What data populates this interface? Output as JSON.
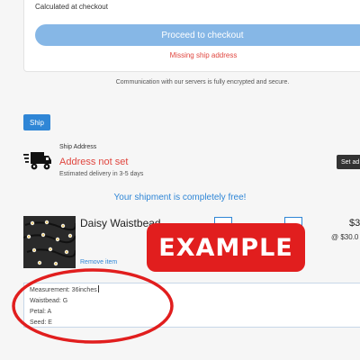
{
  "summary": {
    "calculated_text": "Calculated at checkout",
    "checkout_label": "Proceed to checkout",
    "missing_text": "Missing ship address",
    "secure_text": "Communication with our servers is fully encrypted and secure."
  },
  "ship": {
    "tab_label": "Ship",
    "address_label": "Ship Address",
    "address_status": "Address not set",
    "estimated_delivery": "Estimated delivery in 3-5 days",
    "set_address_label": "Set ad",
    "free_shipping": "Your shipment is completely free!"
  },
  "item": {
    "name": "Daisy Waistbead",
    "price": "$3",
    "unit_price": "@ $30.0",
    "remove_label": "Remove item",
    "notes": [
      "Measurement: 36inches",
      "Waistbead: G",
      "Petal: A",
      "Seed: E"
    ]
  },
  "overlay": {
    "example_label": "EXAMPLE"
  },
  "colors": {
    "accent": "#2f86d6",
    "error": "#e0463f",
    "overlay_red": "#e11e1e"
  }
}
